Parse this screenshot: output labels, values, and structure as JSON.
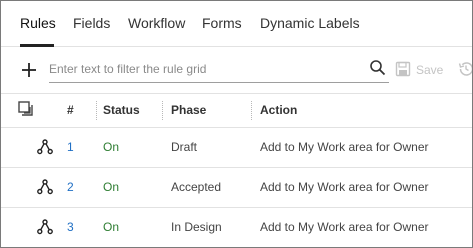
{
  "tabs": [
    {
      "label": "Rules",
      "active": true
    },
    {
      "label": "Fields",
      "active": false
    },
    {
      "label": "Workflow",
      "active": false
    },
    {
      "label": "Forms",
      "active": false
    },
    {
      "label": "Dynamic Labels",
      "active": false
    }
  ],
  "toolbar": {
    "add_icon": "plus-icon",
    "filter_placeholder": "Enter text to filter the rule grid",
    "filter_value": "",
    "search_icon": "search-icon",
    "save_label": "Save",
    "save_enabled": false,
    "history_icon": "history-icon"
  },
  "grid": {
    "columns": {
      "number": "#",
      "status": "Status",
      "phase": "Phase",
      "action": "Action"
    },
    "rows": [
      {
        "number": "1",
        "status": "On",
        "phase": "Draft",
        "action": "Add to My Work area for Owner"
      },
      {
        "number": "2",
        "status": "On",
        "phase": "Accepted",
        "action": "Add to My Work area for Owner"
      },
      {
        "number": "3",
        "status": "On",
        "phase": "In Design",
        "action": "Add to My Work area for Owner"
      }
    ]
  },
  "colors": {
    "link_number": "#1f6fc4",
    "status_on": "#2e7d32",
    "disabled": "#c4c4c4"
  }
}
